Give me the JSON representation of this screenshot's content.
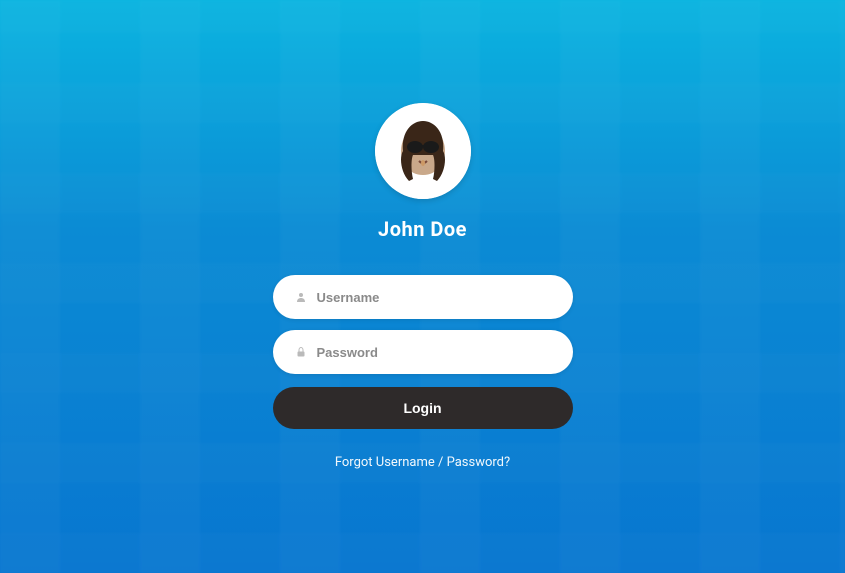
{
  "user": {
    "name": "John Doe"
  },
  "form": {
    "username_placeholder": "Username",
    "password_placeholder": "Password",
    "login_label": "Login"
  },
  "links": {
    "forgot_label": "Forgot Username / Password?"
  },
  "icons": {
    "user": "user-icon",
    "lock": "lock-icon"
  },
  "colors": {
    "bg_top": "#0bb4e0",
    "bg_bottom": "#0876d0",
    "button": "#2e2a2a"
  }
}
